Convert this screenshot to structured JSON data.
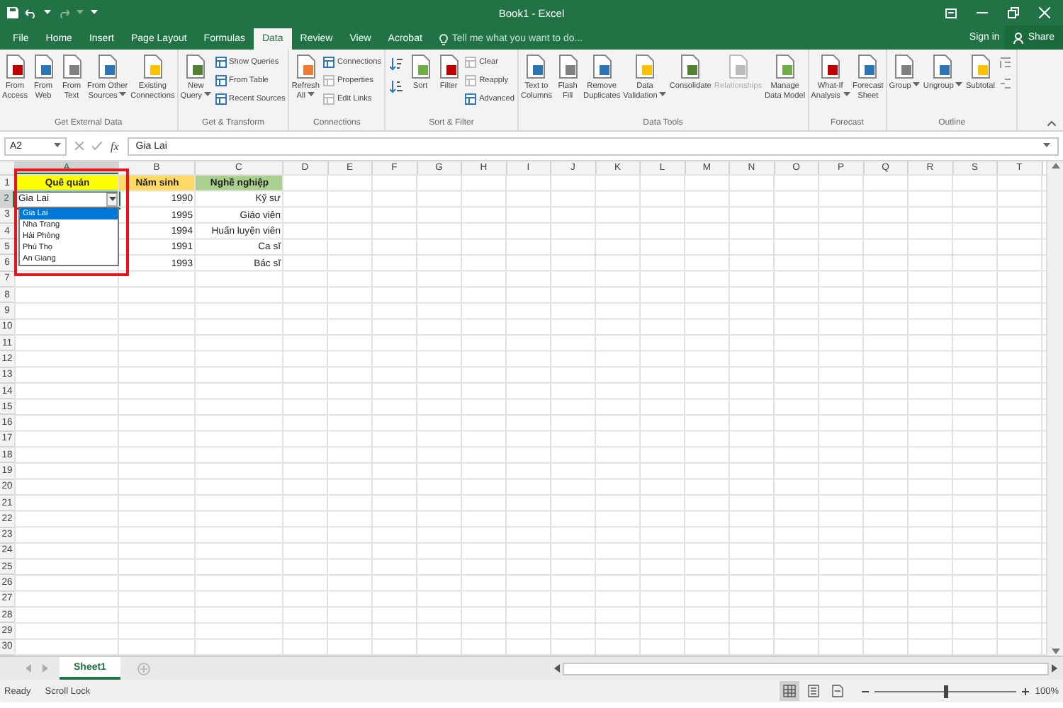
{
  "window": {
    "title": "Book1 - Excel",
    "sign_in": "Sign in",
    "share": "Share"
  },
  "tabs": [
    {
      "label": "File",
      "selected": false
    },
    {
      "label": "Home",
      "selected": false
    },
    {
      "label": "Insert",
      "selected": false
    },
    {
      "label": "Page Layout",
      "selected": false
    },
    {
      "label": "Formulas",
      "selected": false
    },
    {
      "label": "Data",
      "selected": true
    },
    {
      "label": "Review",
      "selected": false
    },
    {
      "label": "View",
      "selected": false
    },
    {
      "label": "Acrobat",
      "selected": false
    }
  ],
  "tell_me": {
    "placeholder": "Tell me what you want to do..."
  },
  "ribbon": {
    "groups": [
      {
        "name": "Get External Data",
        "items": [
          {
            "kind": "large",
            "lines": [
              "From",
              "Access"
            ],
            "dropdown": false,
            "disabled": false
          },
          {
            "kind": "large",
            "lines": [
              "From",
              "Web"
            ],
            "dropdown": false,
            "disabled": false
          },
          {
            "kind": "large",
            "lines": [
              "From",
              "Text"
            ],
            "dropdown": false,
            "disabled": false
          },
          {
            "kind": "large",
            "lines": [
              "From Other",
              "Sources"
            ],
            "dropdown": true,
            "disabled": false
          },
          {
            "kind": "large",
            "lines": [
              "Existing",
              "Connections"
            ],
            "dropdown": false,
            "disabled": false
          }
        ]
      },
      {
        "name": "Get & Transform",
        "items": [
          {
            "kind": "large",
            "lines": [
              "New",
              "Query"
            ],
            "dropdown": true,
            "disabled": false
          },
          {
            "kind": "stack",
            "buttons": [
              {
                "label": "Show Queries",
                "disabled": false
              },
              {
                "label": "From Table",
                "disabled": false
              },
              {
                "label": "Recent Sources",
                "disabled": false
              }
            ]
          }
        ]
      },
      {
        "name": "Connections",
        "items": [
          {
            "kind": "large",
            "lines": [
              "Refresh",
              "All"
            ],
            "dropdown": true,
            "disabled": false
          },
          {
            "kind": "stack",
            "buttons": [
              {
                "label": "Connections",
                "disabled": false
              },
              {
                "label": "Properties",
                "disabled": true
              },
              {
                "label": "Edit Links",
                "disabled": true
              }
            ]
          }
        ]
      },
      {
        "name": "Sort & Filter",
        "items": [
          {
            "kind": "sort"
          },
          {
            "kind": "large",
            "lines": [
              "Sort"
            ],
            "dropdown": false,
            "disabled": false
          },
          {
            "kind": "large",
            "lines": [
              "Filter"
            ],
            "dropdown": false,
            "disabled": false
          },
          {
            "kind": "stack",
            "buttons": [
              {
                "label": "Clear",
                "disabled": true
              },
              {
                "label": "Reapply",
                "disabled": true
              },
              {
                "label": "Advanced",
                "disabled": false
              }
            ]
          }
        ]
      },
      {
        "name": "Data Tools",
        "items": [
          {
            "kind": "large",
            "lines": [
              "Text to",
              "Columns"
            ],
            "dropdown": false,
            "disabled": false
          },
          {
            "kind": "large",
            "lines": [
              "Flash",
              "Fill"
            ],
            "dropdown": false,
            "disabled": false
          },
          {
            "kind": "large",
            "lines": [
              "Remove",
              "Duplicates"
            ],
            "dropdown": false,
            "disabled": false
          },
          {
            "kind": "large",
            "lines": [
              "Data",
              "Validation"
            ],
            "dropdown": true,
            "disabled": false
          },
          {
            "kind": "large",
            "lines": [
              "Consolidate"
            ],
            "dropdown": false,
            "disabled": false
          },
          {
            "kind": "large",
            "lines": [
              "Relationships"
            ],
            "dropdown": false,
            "disabled": true
          },
          {
            "kind": "large",
            "lines": [
              "Manage",
              "Data Model"
            ],
            "dropdown": false,
            "disabled": false
          }
        ]
      },
      {
        "name": "Forecast",
        "items": [
          {
            "kind": "large",
            "lines": [
              "What-If",
              "Analysis"
            ],
            "dropdown": true,
            "disabled": false
          },
          {
            "kind": "large",
            "lines": [
              "Forecast",
              "Sheet"
            ],
            "dropdown": false,
            "disabled": false
          }
        ]
      },
      {
        "name": "Outline",
        "items": [
          {
            "kind": "large",
            "lines": [
              "Group"
            ],
            "dropdown": true,
            "disabled": false
          },
          {
            "kind": "large",
            "lines": [
              "Ungroup"
            ],
            "dropdown": true,
            "disabled": false
          },
          {
            "kind": "large",
            "lines": [
              "Subtotal"
            ],
            "dropdown": false,
            "disabled": false
          },
          {
            "kind": "detail"
          }
        ]
      }
    ]
  },
  "formula_bar": {
    "name_box": "A2",
    "function_label": "fx",
    "value": "Gia Lai"
  },
  "sheet": {
    "columns": [
      {
        "letter": "A",
        "selected": true
      },
      {
        "letter": "B",
        "selected": false
      },
      {
        "letter": "C",
        "selected": false
      },
      {
        "letter": "D",
        "selected": false
      },
      {
        "letter": "E",
        "selected": false
      },
      {
        "letter": "F",
        "selected": false
      },
      {
        "letter": "G",
        "selected": false
      },
      {
        "letter": "H",
        "selected": false
      },
      {
        "letter": "I",
        "selected": false
      },
      {
        "letter": "J",
        "selected": false
      },
      {
        "letter": "K",
        "selected": false
      },
      {
        "letter": "L",
        "selected": false
      },
      {
        "letter": "M",
        "selected": false
      },
      {
        "letter": "N",
        "selected": false
      },
      {
        "letter": "O",
        "selected": false
      },
      {
        "letter": "P",
        "selected": false
      },
      {
        "letter": "Q",
        "selected": false
      },
      {
        "letter": "R",
        "selected": false
      },
      {
        "letter": "S",
        "selected": false
      },
      {
        "letter": "T",
        "selected": false
      }
    ],
    "rows": [
      {
        "number": "1",
        "selected": false,
        "cells": [
          {
            "kind": "heading",
            "text": "Quê quán",
            "color": "#ffff00",
            "active": false
          },
          {
            "kind": "heading",
            "text": "Năm sinh",
            "color": "#ffd966",
            "active": false
          },
          {
            "kind": "heading",
            "text": "Nghề nghiệp",
            "color": "#a9d08e",
            "active": false
          }
        ]
      },
      {
        "number": "2",
        "selected": true,
        "cells": [
          {
            "kind": "left",
            "text": "Gia Lai",
            "active": true
          },
          {
            "kind": "right",
            "text": "1990",
            "active": false
          },
          {
            "kind": "right",
            "text": "Kỹ sư",
            "active": false
          }
        ]
      },
      {
        "number": "3",
        "selected": false,
        "cells": [
          {
            "kind": "empty"
          },
          {
            "kind": "right",
            "text": "1995",
            "active": false
          },
          {
            "kind": "right",
            "text": "Giáo viên",
            "active": false
          }
        ]
      },
      {
        "number": "4",
        "selected": false,
        "cells": [
          {
            "kind": "empty"
          },
          {
            "kind": "right",
            "text": "1994",
            "active": false
          },
          {
            "kind": "right",
            "text": "Huấn luyện viên",
            "active": false
          }
        ]
      },
      {
        "number": "5",
        "selected": false,
        "cells": [
          {
            "kind": "empty"
          },
          {
            "kind": "right",
            "text": "1991",
            "active": false
          },
          {
            "kind": "right",
            "text": "Ca sĩ",
            "active": false
          }
        ]
      },
      {
        "number": "6",
        "selected": false,
        "cells": [
          {
            "kind": "empty"
          },
          {
            "kind": "right",
            "text": "1993",
            "active": false
          },
          {
            "kind": "right",
            "text": "Bác sĩ",
            "active": false
          }
        ]
      },
      {
        "number": "7",
        "selected": false
      },
      {
        "number": "8",
        "selected": false
      },
      {
        "number": "9",
        "selected": false
      },
      {
        "number": "10",
        "selected": false
      },
      {
        "number": "11",
        "selected": false
      },
      {
        "number": "12",
        "selected": false
      },
      {
        "number": "13",
        "selected": false
      },
      {
        "number": "14",
        "selected": false
      },
      {
        "number": "15",
        "selected": false
      },
      {
        "number": "16",
        "selected": false
      },
      {
        "number": "17",
        "selected": false
      },
      {
        "number": "18",
        "selected": false
      },
      {
        "number": "19",
        "selected": false
      },
      {
        "number": "20",
        "selected": false
      },
      {
        "number": "21",
        "selected": false
      },
      {
        "number": "22",
        "selected": false
      },
      {
        "number": "23",
        "selected": false
      },
      {
        "number": "24",
        "selected": false
      },
      {
        "number": "25",
        "selected": false
      },
      {
        "number": "26",
        "selected": false
      },
      {
        "number": "27",
        "selected": false
      },
      {
        "number": "28",
        "selected": false
      },
      {
        "number": "29",
        "selected": false
      },
      {
        "number": "30",
        "selected": false
      }
    ],
    "validation_list": [
      {
        "label": "Gia Lai",
        "selected": true
      },
      {
        "label": "Nha Trang",
        "selected": false
      },
      {
        "label": "Hải Phòng",
        "selected": false
      },
      {
        "label": "Phú Thọ",
        "selected": false
      },
      {
        "label": "An Giang",
        "selected": false
      }
    ]
  },
  "sheet_tabs": [
    {
      "label": "Sheet1",
      "selected": true
    }
  ],
  "status_bar": {
    "messages": [
      "Ready",
      "Scroll Lock"
    ],
    "views": [
      {
        "kind": "normal",
        "selected": true
      },
      {
        "kind": "page-layout",
        "selected": false
      },
      {
        "kind": "page-break",
        "selected": false
      }
    ],
    "zoom": {
      "label": "100%",
      "level": 0.5
    }
  }
}
